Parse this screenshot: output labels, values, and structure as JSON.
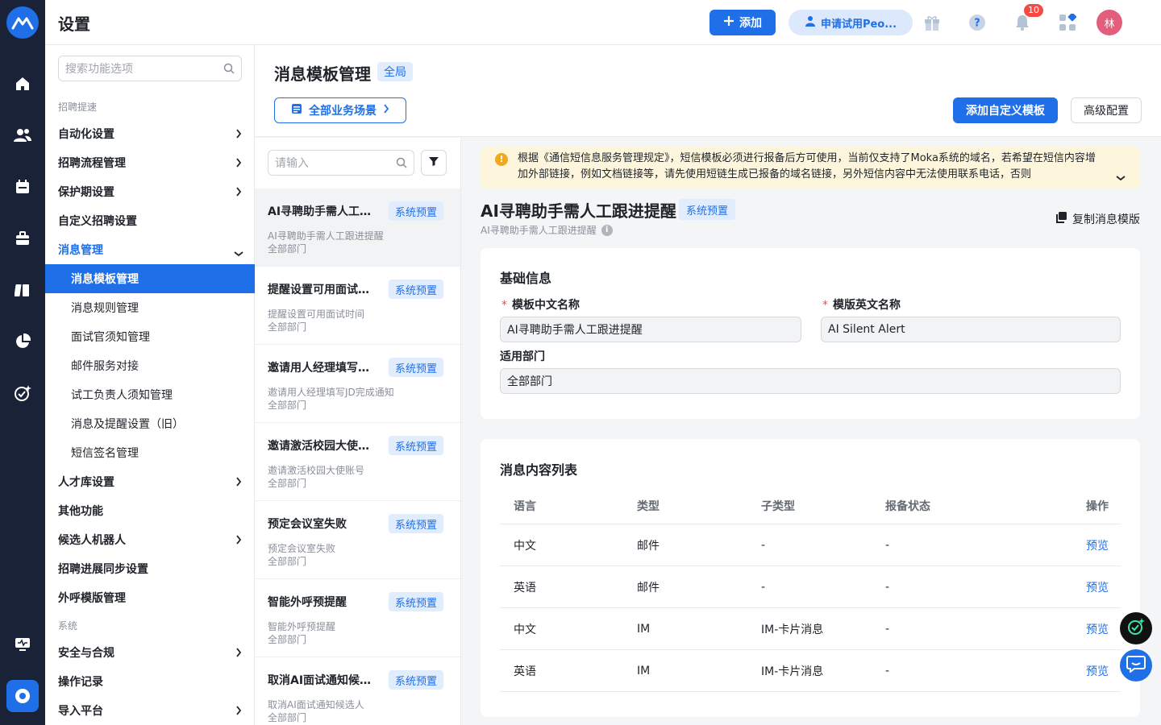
{
  "header": {
    "title": "设置",
    "add_label": "添加",
    "trial_label": "申请试用Peo...",
    "notification_count": "10",
    "avatar_text": "林"
  },
  "sidebar": {
    "search_placeholder": "搜索功能选项",
    "group1": "招聘提速",
    "items": [
      {
        "label": "自动化设置"
      },
      {
        "label": "招聘流程管理"
      },
      {
        "label": "保护期设置"
      },
      {
        "label": "自定义招聘设置"
      },
      {
        "label": "消息管理"
      },
      {
        "label": "人才库设置"
      },
      {
        "label": "其他功能"
      },
      {
        "label": "候选人机器人"
      },
      {
        "label": "招聘进展同步设置"
      },
      {
        "label": "外呼模版管理"
      }
    ],
    "subitems": [
      {
        "label": "消息模板管理"
      },
      {
        "label": "消息规则管理"
      },
      {
        "label": "面试官须知管理"
      },
      {
        "label": "邮件服务对接"
      },
      {
        "label": "试工负责人须知管理"
      },
      {
        "label": "消息及提醒设置（旧）"
      },
      {
        "label": "短信签名管理"
      }
    ],
    "group2": "系统",
    "items2": [
      {
        "label": "安全与合规"
      },
      {
        "label": "操作记录"
      },
      {
        "label": "导入平台"
      }
    ]
  },
  "page": {
    "title": "消息模板管理",
    "scope_tag": "全局",
    "scene_label": "全部业务场景",
    "add_custom_label": "添加自定义模板",
    "advanced_label": "高级配置"
  },
  "template_list": {
    "search_placeholder": "请输入",
    "items": [
      {
        "name": "AI寻聘助手需人工跟进提醒",
        "tag": "系统预置",
        "desc": "AI寻聘助手需人工跟进提醒",
        "dept": "全部部门"
      },
      {
        "name": "提醒设置可用面试时间",
        "tag": "系统预置",
        "desc": "提醒设置可用面试时间",
        "dept": "全部部门"
      },
      {
        "name": "邀请用人经理填写JD完成通知",
        "tag": "系统预置",
        "desc": "邀请用人经理填写JD完成通知",
        "dept": "全部部门"
      },
      {
        "name": "邀请激活校园大使账号",
        "tag": "系统预置",
        "desc": "邀请激活校园大使账号",
        "dept": "全部部门"
      },
      {
        "name": "预定会议室失败",
        "tag": "系统预置",
        "desc": "预定会议室失败",
        "dept": "全部部门"
      },
      {
        "name": "智能外呼预提醒",
        "tag": "系统预置",
        "desc": "智能外呼预提醒",
        "dept": "全部部门"
      },
      {
        "name": "取消AI面试通知候选人",
        "tag": "系统预置",
        "desc": "取消AI面试通知候选人",
        "dept": "全部部门"
      }
    ]
  },
  "notice": {
    "text": "根据《通信短信息服务管理规定》，短信模板必须进行报备后方可使用，当前仅支持了Moka系统的域名，若希望在短信内容增加外部链接，例如文档链接等，请先使用短链生成已报备的域名链接，另外短信内容中无法使用联系电话，否则"
  },
  "detail": {
    "title": "AI寻聘助手需人工跟进提醒",
    "tag": "系统预置",
    "subtitle": "AI寻聘助手需人工跟进提醒",
    "copy_label": "复制消息模版",
    "basic": {
      "title": "基础信息",
      "cn_label": "模板中文名称",
      "cn_value": "AI寻聘助手需人工跟进提醒",
      "en_label": "模版英文名称",
      "en_value": "AI Silent Alert",
      "dept_label": "适用部门",
      "dept_value": "全部部门"
    },
    "content": {
      "title": "消息内容列表",
      "headers": {
        "lang": "语言",
        "type": "类型",
        "subtype": "子类型",
        "status": "报备状态",
        "action": "操作"
      },
      "rows": [
        {
          "lang": "中文",
          "type": "邮件",
          "subtype": "-",
          "status": "-",
          "action": "预览"
        },
        {
          "lang": "英语",
          "type": "邮件",
          "subtype": "-",
          "status": "-",
          "action": "预览"
        },
        {
          "lang": "中文",
          "type": "IM",
          "subtype": "IM-卡片消息",
          "status": "-",
          "action": "预览"
        },
        {
          "lang": "英语",
          "type": "IM",
          "subtype": "IM-卡片消息",
          "status": "-",
          "action": "预览"
        }
      ]
    }
  },
  "colors": {
    "primary": "#1f6fe8",
    "rail": "#1a2238",
    "notice_bg": "#fdf6dd",
    "badge": "#f54a45"
  }
}
